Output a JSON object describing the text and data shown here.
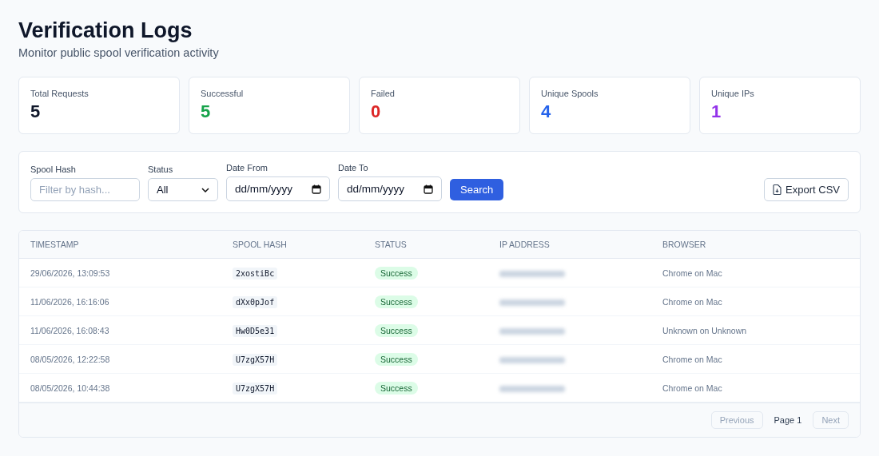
{
  "header": {
    "title": "Verification Logs",
    "subtitle": "Monitor public spool verification activity"
  },
  "stats": [
    {
      "label": "Total Requests",
      "value": "5",
      "color": "#0f172a"
    },
    {
      "label": "Successful",
      "value": "5",
      "color": "#16a34a"
    },
    {
      "label": "Failed",
      "value": "0",
      "color": "#dc2626"
    },
    {
      "label": "Unique Spools",
      "value": "4",
      "color": "#2563eb"
    },
    {
      "label": "Unique IPs",
      "value": "1",
      "color": "#9333ea"
    }
  ],
  "filters": {
    "spool_hash": {
      "label": "Spool Hash",
      "placeholder": "Filter by hash..."
    },
    "status": {
      "label": "Status",
      "value": "All"
    },
    "date_from": {
      "label": "Date From",
      "value": "dd/mm/yyyy"
    },
    "date_to": {
      "label": "Date To",
      "value": "dd/mm/yyyy"
    },
    "search_button": "Search",
    "export_button": "Export CSV"
  },
  "table": {
    "columns": [
      "TIMESTAMP",
      "SPOOL HASH",
      "STATUS",
      "IP ADDRESS",
      "BROWSER"
    ],
    "rows": [
      {
        "timestamp": "29/06/2026, 13:09:53",
        "spool_hash": "2xostiBc",
        "status": "Success",
        "ip_redacted": true,
        "browser": "Chrome on Mac"
      },
      {
        "timestamp": "11/06/2026, 16:16:06",
        "spool_hash": "dXx0pJof",
        "status": "Success",
        "ip_redacted": true,
        "browser": "Chrome on Mac"
      },
      {
        "timestamp": "11/06/2026, 16:08:43",
        "spool_hash": "Hw0D5e31",
        "status": "Success",
        "ip_redacted": true,
        "browser": "Unknown on Unknown"
      },
      {
        "timestamp": "08/05/2026, 12:22:58",
        "spool_hash": "U7zgX57H",
        "status": "Success",
        "ip_redacted": true,
        "browser": "Chrome on Mac"
      },
      {
        "timestamp": "08/05/2026, 10:44:38",
        "spool_hash": "U7zgX57H",
        "status": "Success",
        "ip_redacted": true,
        "browser": "Chrome on Mac"
      }
    ]
  },
  "pagination": {
    "previous": {
      "label": "Previous",
      "disabled": true
    },
    "page": "Page 1",
    "next": {
      "label": "Next",
      "disabled": true
    }
  }
}
